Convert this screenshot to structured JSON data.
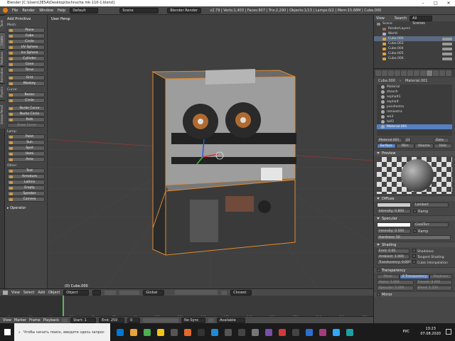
{
  "window": {
    "title": "Blender [C:\\Users\\3ESA\\Desktop\\tschnsche mk-110-1.blend]"
  },
  "menubar": {
    "items": [
      "File",
      "Render",
      "Window",
      "Help"
    ],
    "layout": "Default",
    "scene": "Scene",
    "engine": "Blender Render",
    "stats": "v2.79 | Verts:1,403 | Faces:807 | Tris:2,290 | Objects:1/13 | Lamps:0/2 | Mem:15.68M | Cube.000"
  },
  "left_tabs": [
    "Tools",
    "Create",
    "Relations",
    "Animation",
    "Physics",
    "Grease Pencil"
  ],
  "toolshelf": {
    "title": "Add Primitive",
    "mesh_label": "Mesh:",
    "mesh": [
      "Plane",
      "Cube",
      "Circle",
      "UV Sphere",
      "Ico Sphere",
      "Cylinder",
      "Cone",
      "Torus"
    ],
    "mesh2": [
      "Grid",
      "Monkey"
    ],
    "curve_label": "Curve:",
    "curve": [
      "Bezier",
      "Circle"
    ],
    "curve2": [
      "Nurbs Curve",
      "Nurbs Circle",
      "Path"
    ],
    "curve_dim": "Draw Curve",
    "lamp_label": "Lamp:",
    "lamp": [
      "Point",
      "Sun",
      "Spot",
      "Hemi",
      "Area"
    ],
    "other_label": "Other:",
    "other": [
      "Text",
      "Armature",
      "Lattice",
      "Empty",
      "Speaker",
      "Camera"
    ],
    "operator": "Operator"
  },
  "viewport": {
    "label": "User Persp",
    "object": "(0) Cube.000"
  },
  "vp_header": {
    "items": [
      "View",
      "Select",
      "Add",
      "Object"
    ],
    "mode": "Object Mode",
    "pivot": "Global",
    "snap": "Closest"
  },
  "timeline": {
    "ticks": [
      "-40",
      "-20",
      "0",
      "20",
      "40",
      "60",
      "80",
      "100",
      "120",
      "140",
      "160",
      "180",
      "200",
      "220",
      "240",
      "260",
      "280"
    ],
    "menu": [
      "View",
      "Marker",
      "Frame",
      "Playback"
    ],
    "start_label": "Start:",
    "start": "1",
    "end_label": "End:",
    "end": "250",
    "current": "0",
    "sync": "No Sync",
    "keying": "Available"
  },
  "outliner": {
    "menu": [
      "View",
      "Search"
    ],
    "filter": "All Scenes",
    "rows": [
      "Scene",
      "RenderLayers",
      "World",
      "Cube.000",
      "Cube.003",
      "Cube.004",
      "Cube.005",
      "Cube.006"
    ],
    "selected": "Cube.000"
  },
  "properties": {
    "breadcrumb": [
      "Cube.000",
      "Material.001"
    ],
    "materials": [
      "Material",
      "zhesch",
      "asphalt1",
      "asphalt",
      "pandiestra",
      "remiestra",
      "we3",
      "tall3",
      "Material.001"
    ],
    "selected_material": "Material.001",
    "mat_field": "Material.001",
    "mat_count": "13",
    "mat_data": "Data",
    "tabs": [
      "Surface",
      "Wire",
      "Volume",
      "Halo"
    ],
    "preview_label": "Preview",
    "diffuse_label": "Diffuse",
    "diffuse_shader": "Lambert",
    "diffuse_intensity_label": "Intensity:",
    "diffuse_intensity": "0.800",
    "ramp_label": "Ramp",
    "specular_label": "Specular",
    "specular_shader": "CookTorr",
    "specular_intensity_label": "Intensity:",
    "specular_intensity": "0.500",
    "hardness_label": "Hardness:",
    "hardness": "50",
    "shading_label": "Shading",
    "emit_label": "Emit:",
    "emit": "0.00",
    "ambient_label": "Ambient:",
    "ambient": "1.000",
    "translucency_label": "Translucency:",
    "translucency": "0.000",
    "shadeless": "Shadeless",
    "tangent": "Tangent Shading",
    "cubic": "Cubic Interpolation",
    "transparency_label": "Transparency",
    "transp_modes": [
      "Mask",
      "Z Transparency",
      "Raytrace"
    ],
    "alpha_label": "Alpha:",
    "alpha": "1.000",
    "fresnel_label": "Fresnel:",
    "fresnel": "0.000",
    "specular2_label": "Specular:",
    "specular2": "1.000",
    "blend_label": "Blend:",
    "blend": "1.250",
    "mirror_label": "Mirror"
  },
  "taskbar": {
    "search": "Чтобы начать поиск, введите здесь запрос",
    "time": "13:23",
    "date": "07.08.2020",
    "lang": "РУС",
    "icon_colors": [
      "#0078d7",
      "#e8a33a",
      "#4caf50",
      "#f5c518",
      "#555555",
      "#e26a2c",
      "#333333",
      "#1f8ad6",
      "#555555",
      "#444444",
      "#777777",
      "#7a4fa8",
      "#d23a3a",
      "#444444",
      "#2c6fd1",
      "#a83a7a",
      "#31a8ff",
      "#1da1a1"
    ]
  },
  "colors": {
    "accent": "#5680c2",
    "selection_outline": "#e08a30",
    "window_bg": "#3d3d3d"
  }
}
